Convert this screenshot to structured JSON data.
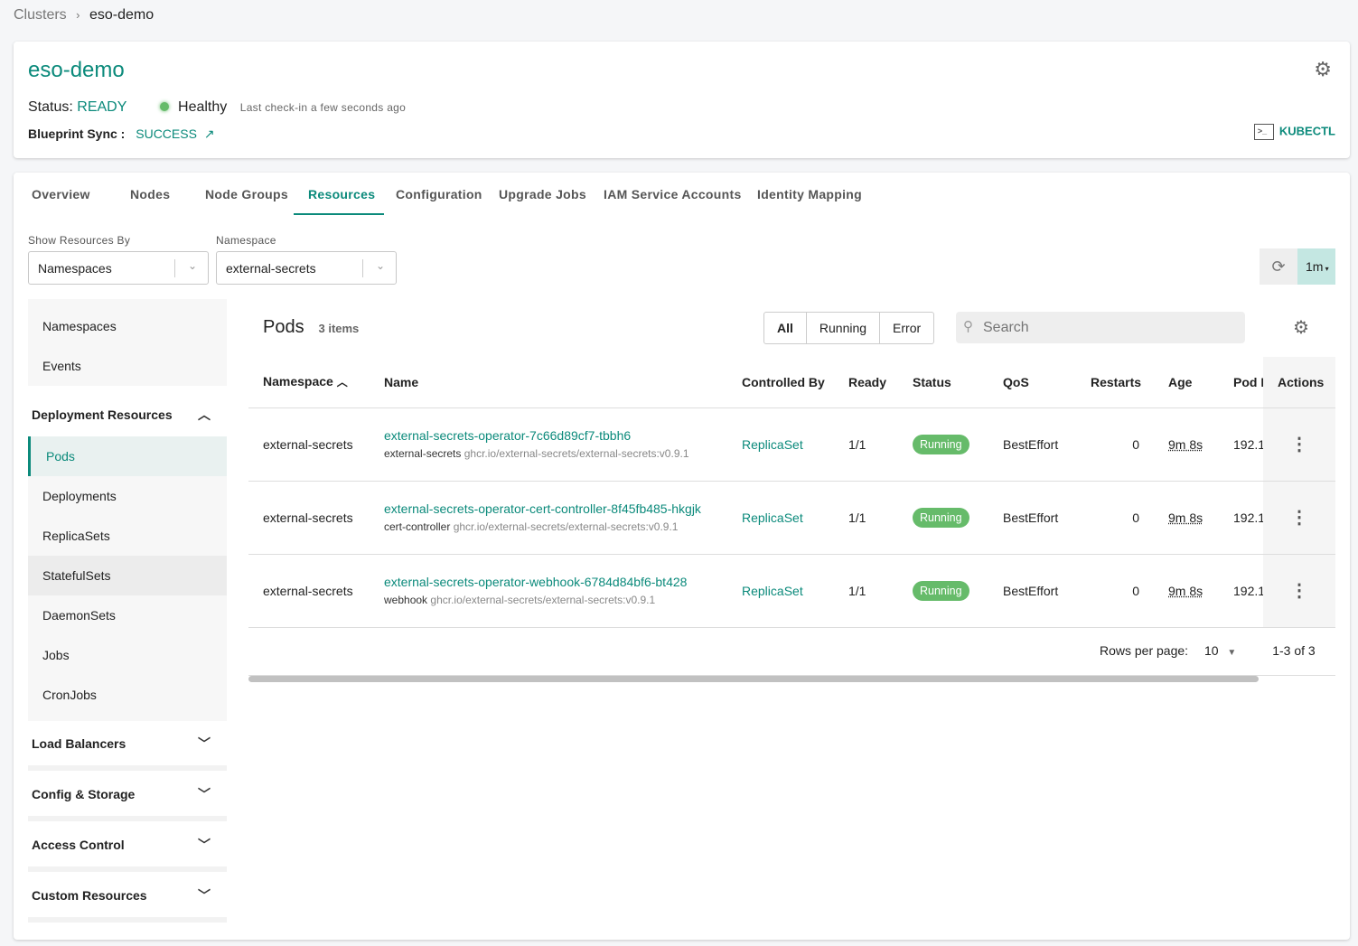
{
  "breadcrumb": {
    "parent": "Clusters",
    "sep": "›",
    "current": "eso-demo"
  },
  "cluster": {
    "name": "eso-demo",
    "status_label": "Status:",
    "status": "READY",
    "health": "Healthy",
    "last_checkin": "Last check-in a few seconds ago",
    "blueprint_label": "Blueprint Sync :",
    "blueprint_status": "SUCCESS",
    "kubectl": "KUBECTL"
  },
  "tabs": [
    "Overview",
    "Nodes",
    "Node Groups",
    "Resources",
    "Configuration",
    "Upgrade Jobs",
    "IAM Service Accounts",
    "Identity Mapping"
  ],
  "active_tab": "Resources",
  "filters": {
    "show_by_label": "Show Resources By",
    "show_by_value": "Namespaces",
    "namespace_label": "Namespace",
    "namespace_value": "external-secrets",
    "refresh_interval": "1m"
  },
  "sidebar": {
    "top": [
      "Namespaces",
      "Events"
    ],
    "deployment_header": "Deployment Resources",
    "deployment_items": [
      "Pods",
      "Deployments",
      "ReplicaSets",
      "StatefulSets",
      "DaemonSets",
      "Jobs",
      "CronJobs"
    ],
    "active": "Pods",
    "groups": [
      "Load Balancers",
      "Config & Storage",
      "Access Control",
      "Custom Resources"
    ]
  },
  "pods": {
    "title": "Pods",
    "count": "3 items",
    "filters": [
      "All",
      "Running",
      "Error"
    ],
    "active_filter": "All",
    "search_placeholder": "Search",
    "columns": [
      "Namespace",
      "Name",
      "Controlled By",
      "Ready",
      "Status",
      "QoS",
      "Restarts",
      "Age",
      "Pod IP",
      "Actions"
    ],
    "rows": [
      {
        "namespace": "external-secrets",
        "name": "external-secrets-operator-7c66d89cf7-tbbh6",
        "container": "external-secrets",
        "image": "ghcr.io/external-secrets/external-secrets:v0.9.1",
        "controlled_by": "ReplicaSet",
        "ready": "1/1",
        "status": "Running",
        "qos": "BestEffort",
        "restarts": "0",
        "age": "9m 8s",
        "pod_ip": "192.1"
      },
      {
        "namespace": "external-secrets",
        "name": "external-secrets-operator-cert-controller-8f45fb485-hkgjk",
        "container": "cert-controller",
        "image": "ghcr.io/external-secrets/external-secrets:v0.9.1",
        "controlled_by": "ReplicaSet",
        "ready": "1/1",
        "status": "Running",
        "qos": "BestEffort",
        "restarts": "0",
        "age": "9m 8s",
        "pod_ip": "192.1"
      },
      {
        "namespace": "external-secrets",
        "name": "external-secrets-operator-webhook-6784d84bf6-bt428",
        "container": "webhook",
        "image": "ghcr.io/external-secrets/external-secrets:v0.9.1",
        "controlled_by": "ReplicaSet",
        "ready": "1/1",
        "status": "Running",
        "qos": "BestEffort",
        "restarts": "0",
        "age": "9m 8s",
        "pod_ip": "192.1"
      }
    ],
    "rows_per_page_label": "Rows per page:",
    "rows_per_page": "10",
    "range": "1-3 of 3"
  },
  "colors": {
    "accent": "#0b8a7b",
    "running": "#66bb6a",
    "refresh_bg": "#c4e7e2"
  }
}
